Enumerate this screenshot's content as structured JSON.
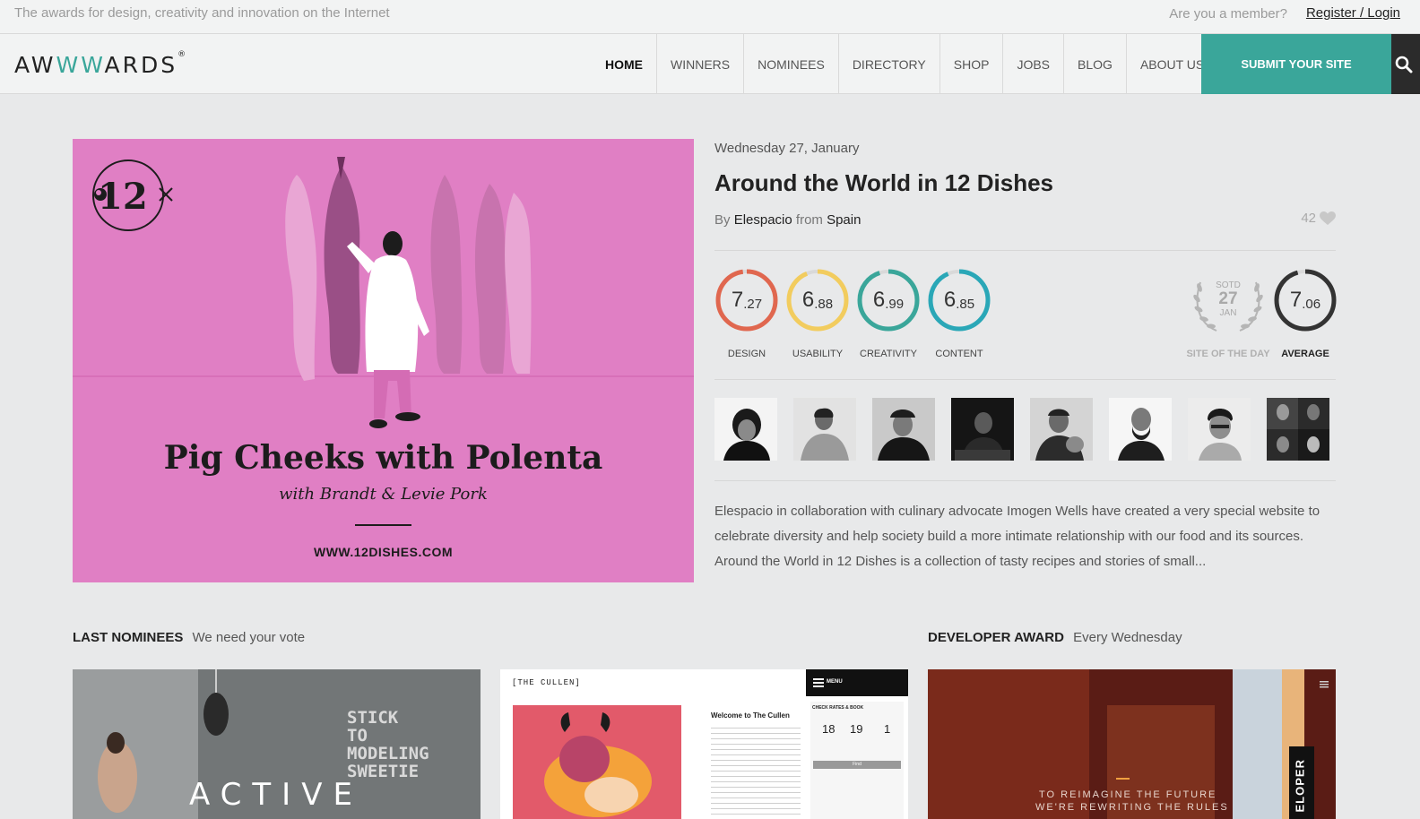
{
  "topbar": {
    "tagline": "The awards for design, creativity and innovation on the Internet",
    "member_prompt": "Are you a member?",
    "login_link": "Register / Login"
  },
  "logo": {
    "part1": "AW",
    "part2": "WW",
    "part3": "ARDS",
    "reg": "®"
  },
  "nav": {
    "items": [
      "HOME",
      "WINNERS",
      "NOMINEES",
      "DIRECTORY",
      "SHOP",
      "JOBS",
      "BLOG",
      "ABOUT US"
    ],
    "submit": "SUBMIT YOUR SITE",
    "search_icon": "search-icon"
  },
  "hero": {
    "stamp": "12",
    "dish_title": "Pig Cheeks with Polenta",
    "dish_subtitle": "with Brandt & Levie Pork",
    "url": "WWW.12DISHES.COM"
  },
  "site": {
    "date": "Wednesday 27, January",
    "title": "Around the World in 12 Dishes",
    "by_prefix": "By",
    "author": "Elespacio",
    "from_word": "from",
    "country": "Spain",
    "likes": "42",
    "description": "Elespacio in collaboration with culinary advocate Imogen Wells have created a very special website to celebrate diversity and help society build a more intimate relationship with our food and its sources. Around the World in 12 Dishes is a collection of tasty recipes and stories of small..."
  },
  "scores": [
    {
      "label": "DESIGN",
      "int": "7",
      "dec": ".27",
      "value": 7.27,
      "color": "#e0674f"
    },
    {
      "label": "USABILITY",
      "int": "6",
      "dec": ".88",
      "value": 6.88,
      "color": "#f2cc5e"
    },
    {
      "label": "CREATIVITY",
      "int": "6",
      "dec": ".99",
      "value": 6.99,
      "color": "#3aa69a"
    },
    {
      "label": "CONTENT",
      "int": "6",
      "dec": ".85",
      "value": 6.85,
      "color": "#2aa7b7"
    }
  ],
  "sotd": {
    "line1": "SOTD",
    "day": "27",
    "month": "JAN",
    "label": "SITE OF THE DAY"
  },
  "average": {
    "label": "AVERAGE",
    "int": "7",
    "dec": ".06",
    "value": 7.06,
    "color": "#333333"
  },
  "sections": {
    "nominees_title": "LAST NOMINEES",
    "nominees_sub": "We need your vote",
    "developer_title": "DEVELOPER AWARD",
    "developer_sub": "Every Wednesday"
  },
  "cards": {
    "active": {
      "word": "ACTIVE",
      "sign": "STICK TO MODELING SWEETIE"
    },
    "cullen": {
      "brand": "[THE CULLEN]",
      "menu": "MENU",
      "welcome": "Welcome to The Cullen",
      "check_rates": "CHECK RATES & BOOK",
      "d1": "18",
      "d2": "19",
      "d3": "1",
      "find": "Find"
    },
    "developer": {
      "tagline1": "TO REIMAGINE THE FUTURE",
      "tagline2": "WE'RE REWRITING THE RULES",
      "vertical": "ELOPER"
    }
  }
}
